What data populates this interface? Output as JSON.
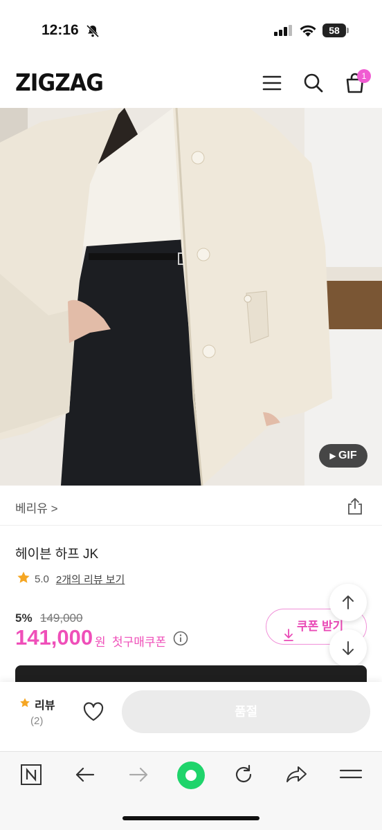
{
  "status_bar": {
    "time": "12:16",
    "battery": "58"
  },
  "header": {
    "logo": "ZIGZAG",
    "cart_count": "1"
  },
  "hero": {
    "badge": "GIF"
  },
  "store": {
    "name": "베리유 >"
  },
  "product": {
    "title": "헤이븐 하프 JK",
    "rating": "5.0",
    "review_link": "2개의 리뷰 보기",
    "discount": "5%",
    "original_price": "149,000",
    "price": "141,000",
    "currency": "원",
    "first_purchase_coupon": "첫구매쿠폰",
    "coupon_button": "쿠폰 받기"
  },
  "action_bar": {
    "review_label": "리뷰",
    "review_count": "(2)",
    "sold_out_label": "품절"
  },
  "colors": {
    "accent": "#ef4fb9",
    "brand_badge": "#f05cd2",
    "browser_green": "#1fd46b"
  },
  "icons": [
    "bell-slash-icon",
    "signal-icon",
    "wifi-icon",
    "menu-icon",
    "search-icon",
    "cart-icon",
    "share-icon",
    "star-icon",
    "info-icon",
    "download-icon",
    "arrow-up-icon",
    "arrow-down-icon",
    "heart-icon",
    "naver-n-icon",
    "back-icon",
    "forward-icon",
    "green-dot-icon",
    "reload-icon",
    "share-forward-icon",
    "browser-menu-icon"
  ]
}
